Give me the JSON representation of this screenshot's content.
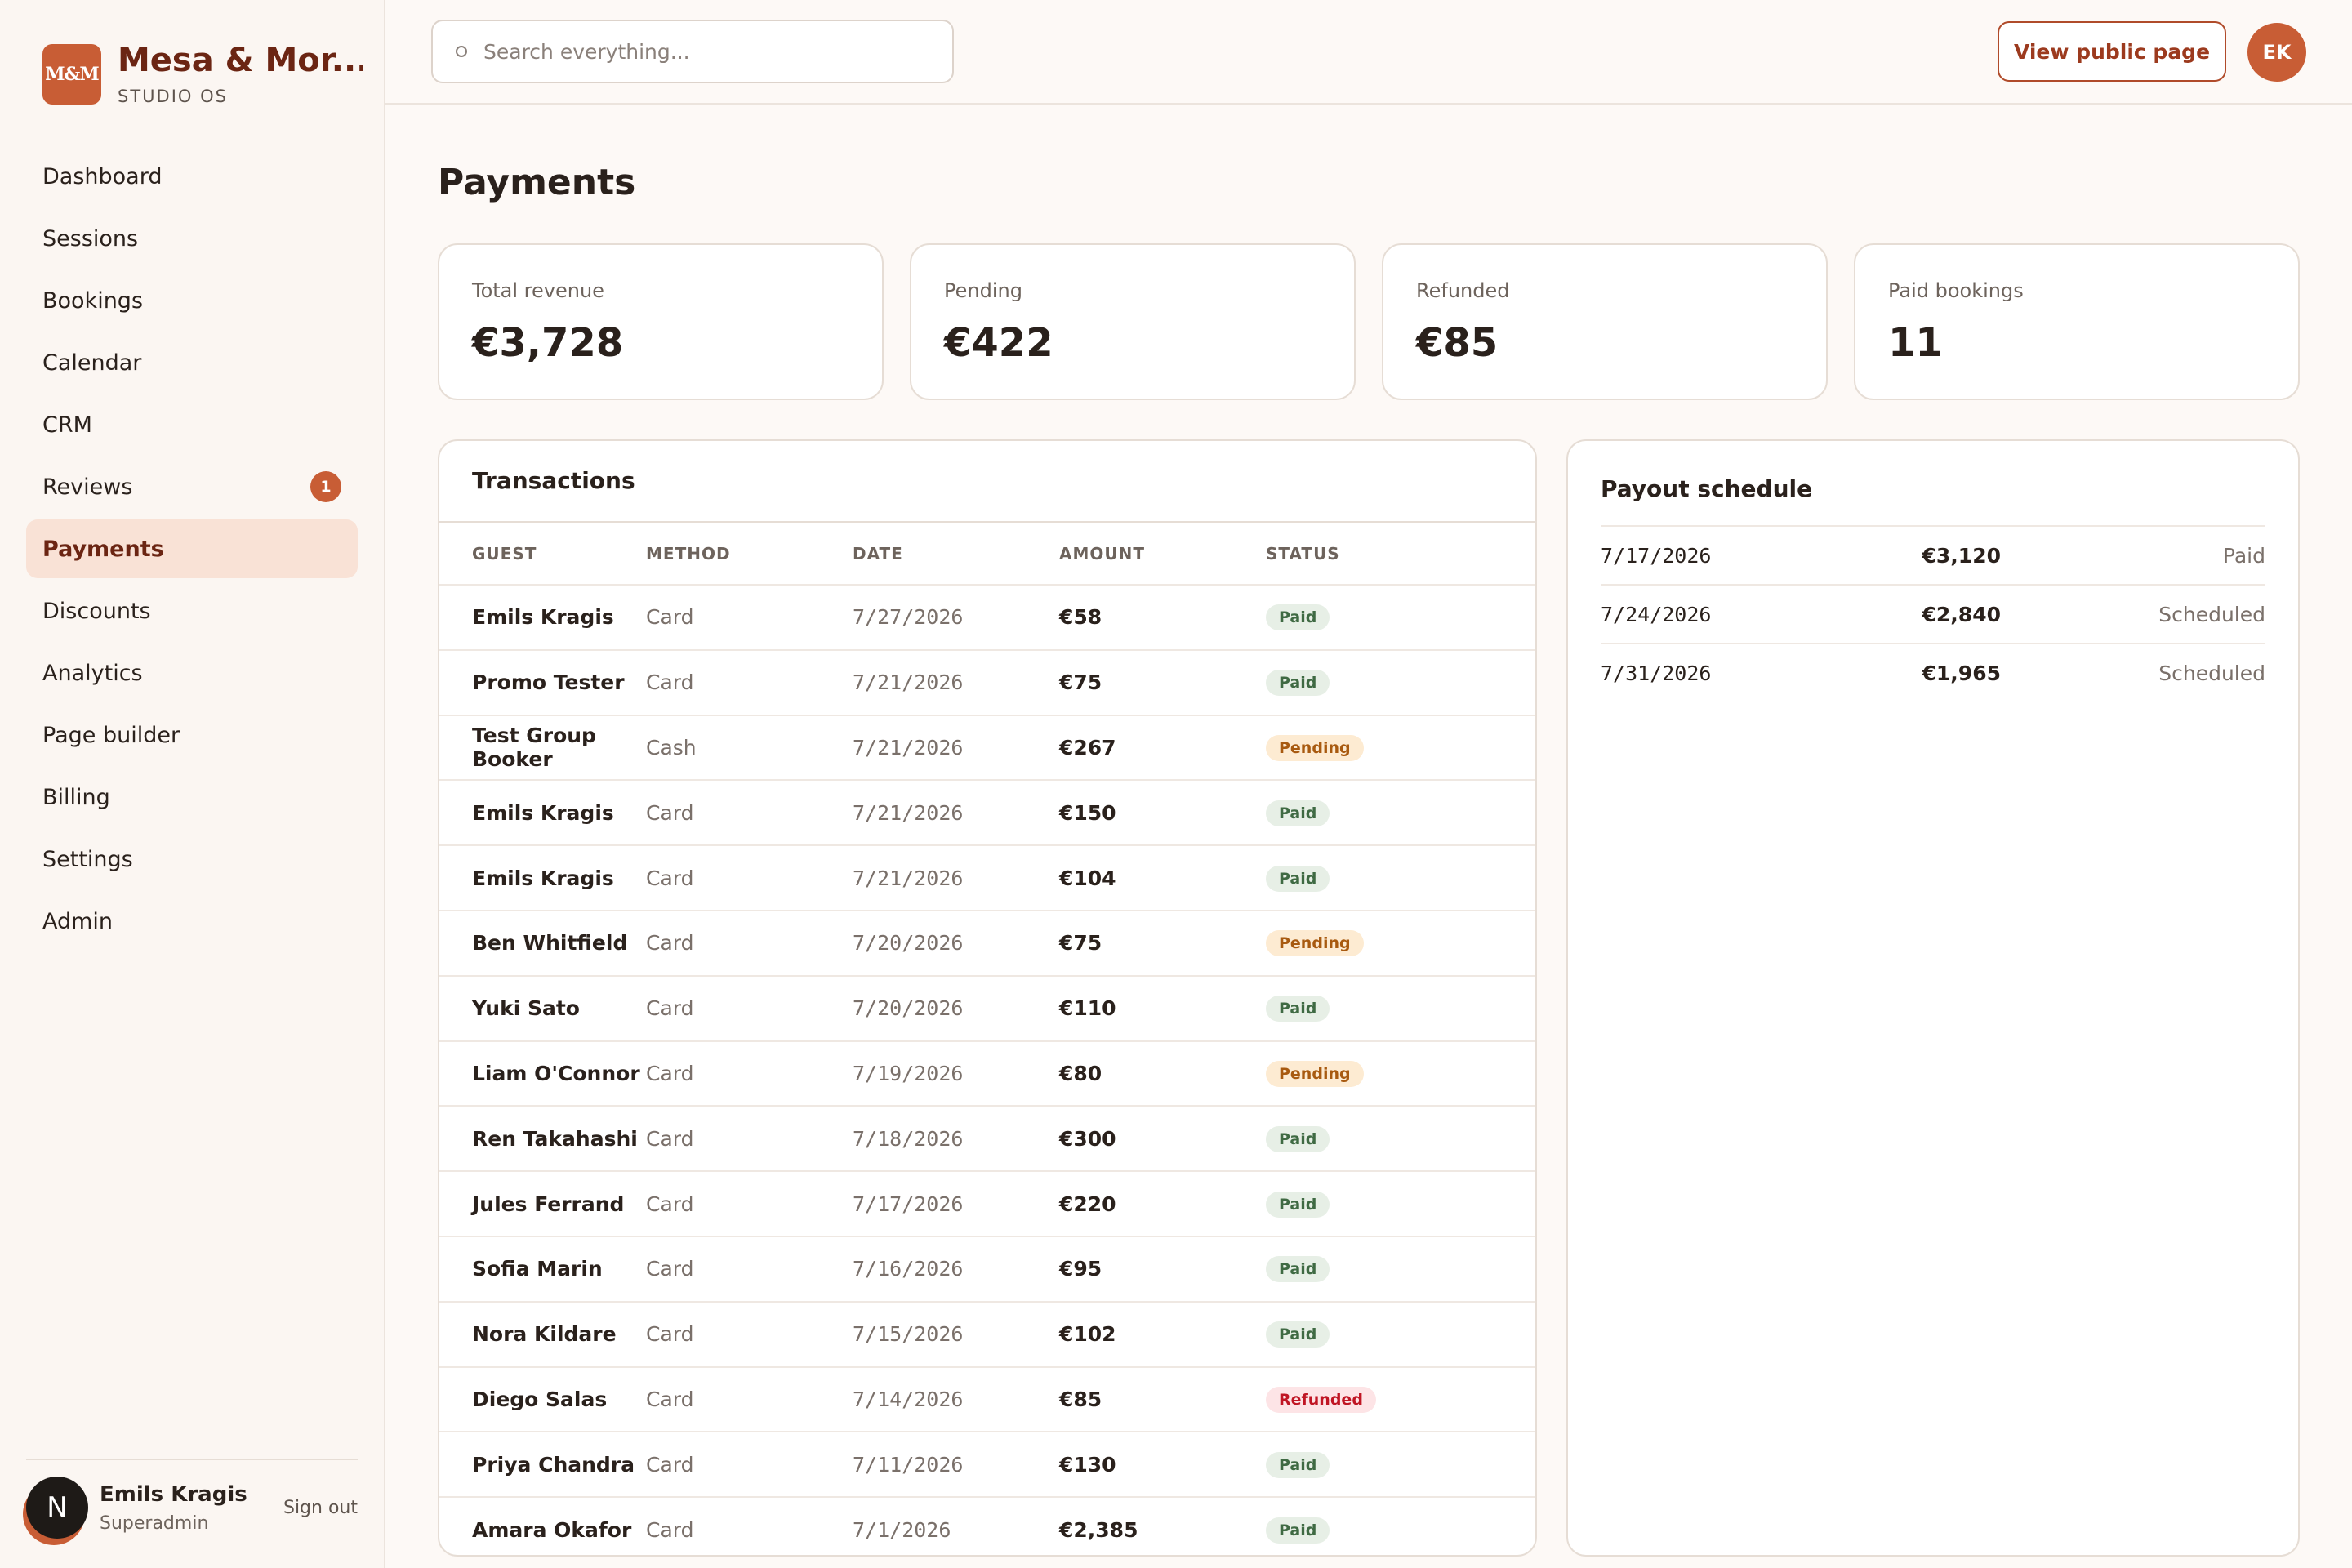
{
  "brand": {
    "logo_text": "M&M",
    "name": "Mesa & Mor...",
    "subtitle": "STUDIO OS"
  },
  "sidebar": {
    "items": [
      {
        "label": "Dashboard"
      },
      {
        "label": "Sessions"
      },
      {
        "label": "Bookings"
      },
      {
        "label": "Calendar"
      },
      {
        "label": "CRM"
      },
      {
        "label": "Reviews",
        "badge": "1"
      },
      {
        "label": "Payments",
        "active": true
      },
      {
        "label": "Discounts"
      },
      {
        "label": "Analytics"
      },
      {
        "label": "Page builder"
      },
      {
        "label": "Billing"
      },
      {
        "label": "Settings"
      },
      {
        "label": "Admin"
      }
    ]
  },
  "user": {
    "avatar_letter": "N",
    "name": "Emils Kragis",
    "role": "Superadmin",
    "signout_label": "Sign out"
  },
  "topbar": {
    "search_placeholder": "Search everything...",
    "search_value": "",
    "public_button_label": "View public page",
    "avatar_initials": "EK"
  },
  "page": {
    "title": "Payments"
  },
  "stats": [
    {
      "label": "Total revenue",
      "value": "€3,728"
    },
    {
      "label": "Pending",
      "value": "€422"
    },
    {
      "label": "Refunded",
      "value": "€85"
    },
    {
      "label": "Paid bookings",
      "value": "11"
    }
  ],
  "transactions": {
    "title": "Transactions",
    "columns": [
      "GUEST",
      "METHOD",
      "DATE",
      "AMOUNT",
      "STATUS"
    ],
    "rows": [
      {
        "guest": "Emils Kragis",
        "method": "Card",
        "date": "7/27/2026",
        "amount": "€58",
        "status": "Paid"
      },
      {
        "guest": "Promo Tester",
        "method": "Card",
        "date": "7/21/2026",
        "amount": "€75",
        "status": "Paid"
      },
      {
        "guest": "Test Group Booker",
        "method": "Cash",
        "date": "7/21/2026",
        "amount": "€267",
        "status": "Pending"
      },
      {
        "guest": "Emils Kragis",
        "method": "Card",
        "date": "7/21/2026",
        "amount": "€150",
        "status": "Paid"
      },
      {
        "guest": "Emils Kragis",
        "method": "Card",
        "date": "7/21/2026",
        "amount": "€104",
        "status": "Paid"
      },
      {
        "guest": "Ben Whitfield",
        "method": "Card",
        "date": "7/20/2026",
        "amount": "€75",
        "status": "Pending"
      },
      {
        "guest": "Yuki Sato",
        "method": "Card",
        "date": "7/20/2026",
        "amount": "€110",
        "status": "Paid"
      },
      {
        "guest": "Liam O'Connor",
        "method": "Card",
        "date": "7/19/2026",
        "amount": "€80",
        "status": "Pending"
      },
      {
        "guest": "Ren Takahashi",
        "method": "Card",
        "date": "7/18/2026",
        "amount": "€300",
        "status": "Paid"
      },
      {
        "guest": "Jules Ferrand",
        "method": "Card",
        "date": "7/17/2026",
        "amount": "€220",
        "status": "Paid"
      },
      {
        "guest": "Sofia Marin",
        "method": "Card",
        "date": "7/16/2026",
        "amount": "€95",
        "status": "Paid"
      },
      {
        "guest": "Nora Kildare",
        "method": "Card",
        "date": "7/15/2026",
        "amount": "€102",
        "status": "Paid"
      },
      {
        "guest": "Diego Salas",
        "method": "Card",
        "date": "7/14/2026",
        "amount": "€85",
        "status": "Refunded"
      },
      {
        "guest": "Priya Chandra",
        "method": "Card",
        "date": "7/11/2026",
        "amount": "€130",
        "status": "Paid"
      },
      {
        "guest": "Amara Okafor",
        "method": "Card",
        "date": "7/1/2026",
        "amount": "€2,385",
        "status": "Paid"
      }
    ]
  },
  "payouts": {
    "title": "Payout schedule",
    "rows": [
      {
        "date": "7/17/2026",
        "amount": "€3,120",
        "status": "Paid"
      },
      {
        "date": "7/24/2026",
        "amount": "€2,840",
        "status": "Scheduled"
      },
      {
        "date": "7/31/2026",
        "amount": "€1,965",
        "status": "Scheduled"
      }
    ]
  },
  "colors": {
    "accent": "#c85d35",
    "brand_text": "#6b2513",
    "active_nav_bg": "#f9e2d6",
    "paid": "#3f6a43",
    "pending": "#a85a10",
    "refunded": "#c01624"
  }
}
